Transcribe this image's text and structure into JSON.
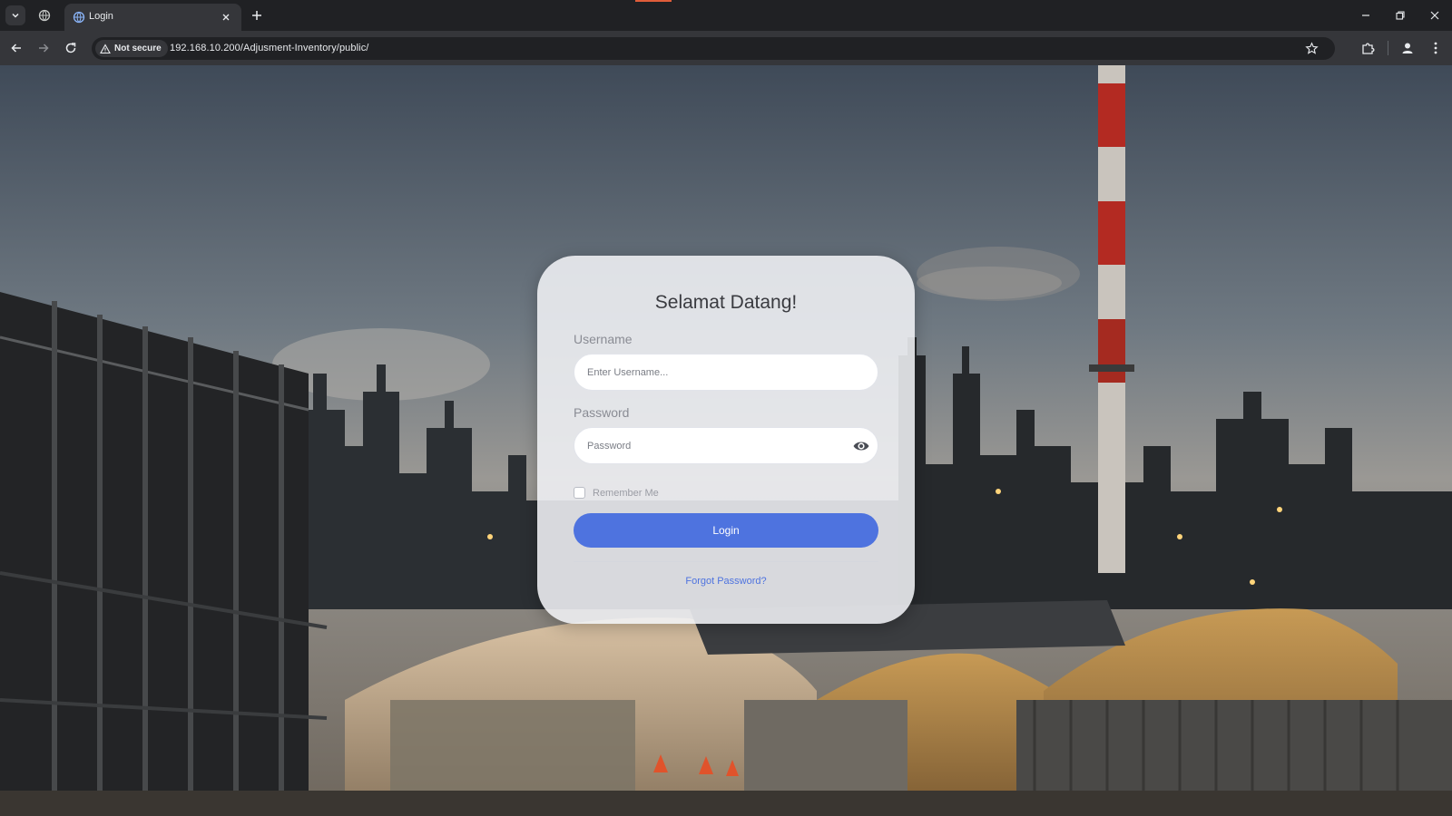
{
  "browser": {
    "tab": {
      "title": "Login",
      "favicon": "globe-icon"
    },
    "address_bar": {
      "security_label": "Not secure",
      "url": "192.168.10.200/Adjusment-Inventory/public/"
    },
    "colors": {
      "frame": "#202124",
      "toolbar": "#35363a",
      "text": "#e8eaed"
    }
  },
  "login": {
    "title": "Selamat Datang!",
    "username_label": "Username",
    "username_placeholder": "Enter Username...",
    "password_label": "Password",
    "password_placeholder": "Password",
    "remember_label": "Remember Me",
    "login_button": "Login",
    "forgot_link": "Forgot Password?",
    "colors": {
      "primary": "#4e73df",
      "card": "#f0f1f5"
    }
  }
}
